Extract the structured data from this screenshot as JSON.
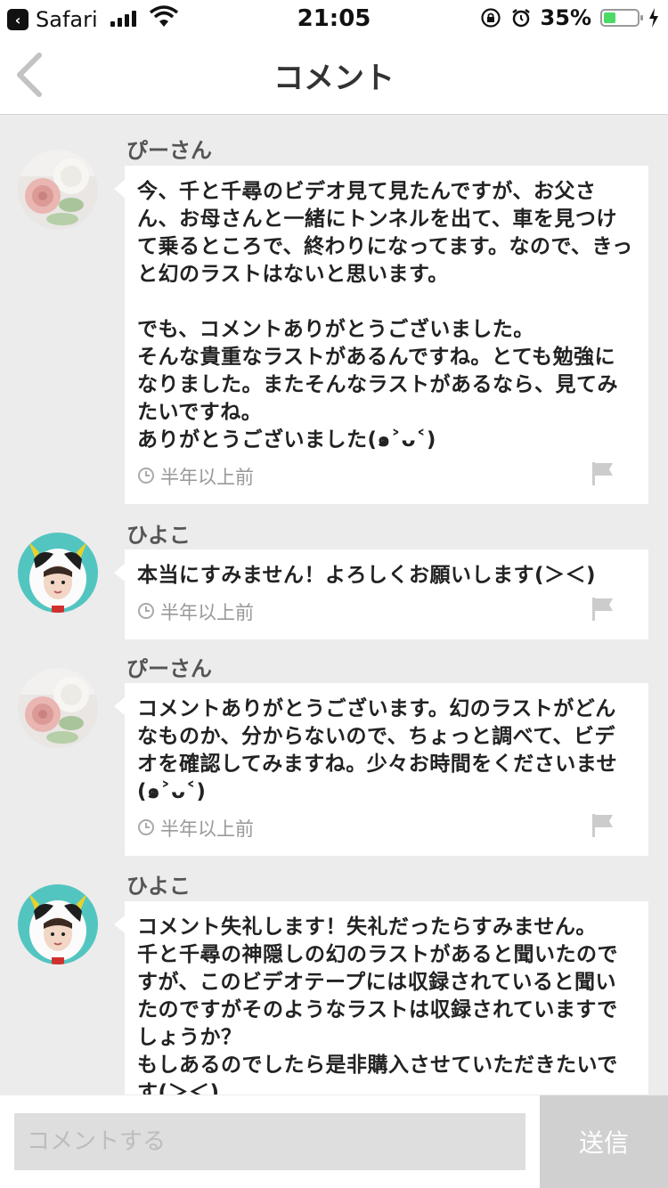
{
  "status_bar": {
    "back_app_label": "Safari",
    "time": "21:05",
    "battery_percent": "35%",
    "battery_level": 0.35
  },
  "navbar": {
    "title": "コメント"
  },
  "comments": [
    {
      "username": "ぴーさん",
      "text": "今、千と千尋のビデオ見て見たんですが、お父さん、お母さんと一緒にトンネルを出て、車を見つけて乗るところで、終わりになってます。なので、きっと幻のラストはないと思います。\n\nでも、コメントありがとうございました。\nそんな貴重なラストがあるんですね。とても勉強になりました。またそんなラストがあるなら、見てみたいですね。\nありがとうございました(๑˃ᴗ˂)",
      "time_ago": "半年以上前"
    },
    {
      "username": "ひよこ",
      "text": "本当にすみません！よろしくお願いします(＞＜)",
      "time_ago": "半年以上前"
    },
    {
      "username": "ぴーさん",
      "text": "コメントありがとうございます。幻のラストがどんなものか、分からないので、ちょっと調べて、ビデオを確認してみますね。少々お時間をくださいませ(๑˃ᴗ˂)",
      "time_ago": "半年以上前"
    },
    {
      "username": "ひよこ",
      "text": "コメント失礼します！失礼だったらすみません。\n千と千尋の神隠しの幻のラストがあると聞いたのですが、このビデオテープには収録されていると聞いたのですがそのようなラストは収録されていますでしょうか？\nもしあるのでしたら是非購入させていただきたいです(＞＜)",
      "time_ago": ""
    }
  ],
  "input_bar": {
    "placeholder": "コメントする",
    "send_label": "送信"
  }
}
